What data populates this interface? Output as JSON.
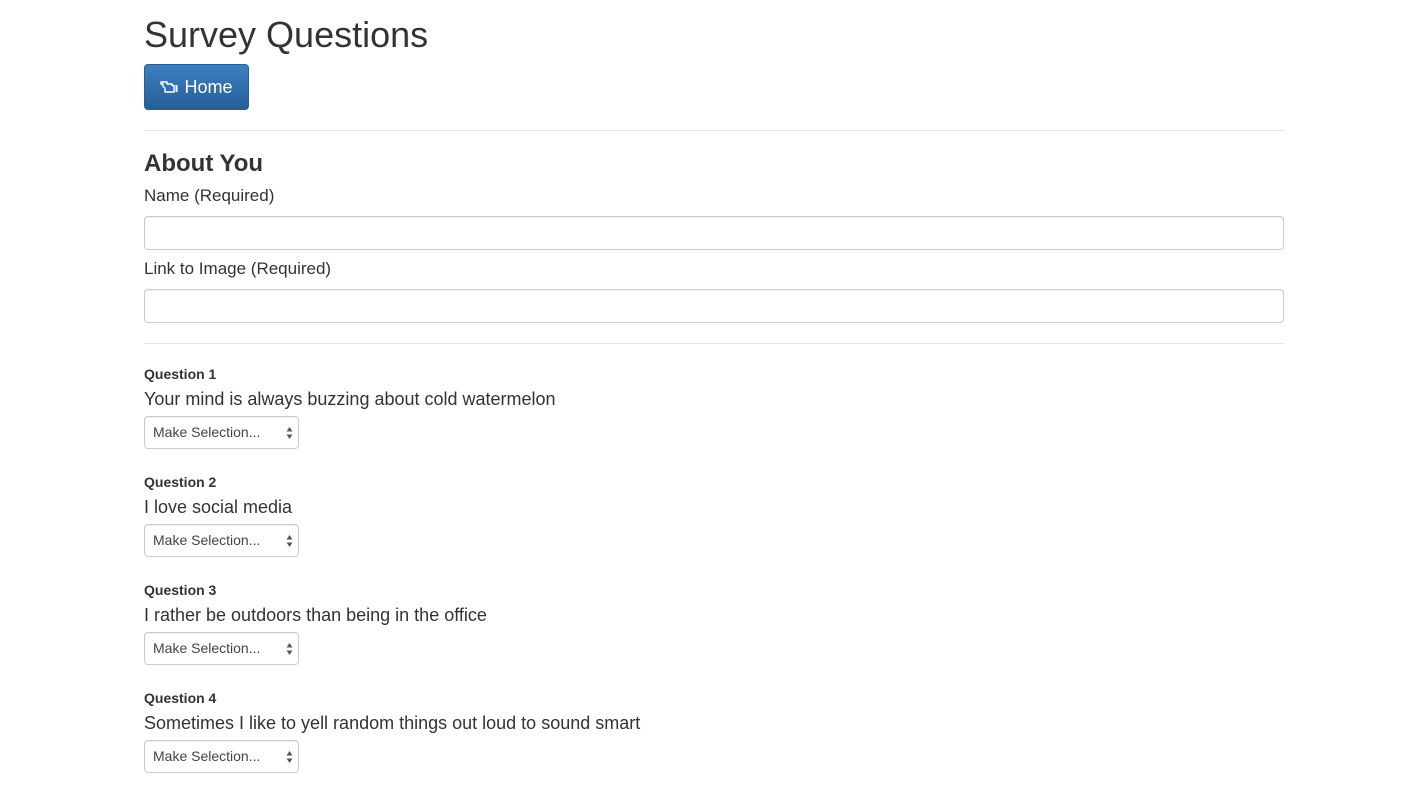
{
  "header": {
    "title": "Survey Questions",
    "home_button": {
      "label": "Home",
      "icon": "hand-pointer-icon"
    }
  },
  "about": {
    "title": "About You",
    "name_label": "Name (Required)",
    "name_value": "",
    "image_label": "Link to Image (Required)",
    "image_value": ""
  },
  "questions": [
    {
      "heading": "Question 1",
      "text": "Your mind is always buzzing about cold watermelon",
      "select": "Make Selection..."
    },
    {
      "heading": "Question 2",
      "text": "I love social media",
      "select": "Make Selection..."
    },
    {
      "heading": "Question 3",
      "text": "I rather be outdoors than being in the office",
      "select": "Make Selection..."
    },
    {
      "heading": "Question 4",
      "text": "Sometimes I like to yell random things out loud to sound smart",
      "select": "Make Selection..."
    }
  ],
  "colors": {
    "primary_button": "#2e6da4",
    "border": "#cccccc",
    "text": "#333333"
  }
}
